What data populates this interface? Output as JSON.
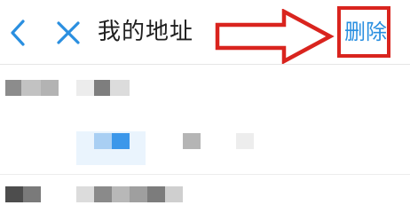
{
  "header": {
    "back_icon": "chevron-left-icon",
    "close_icon": "close-icon",
    "title": "我的地址",
    "delete_label": "删除"
  },
  "annotation": {
    "arrow": "right-arrow-outline",
    "highlight": "red-box"
  },
  "colors": {
    "accent": "#2a8fe0",
    "annotation_red": "#d9241e",
    "title_text": "#1f1f1f",
    "blur_gray": "#9a9a9a"
  },
  "content": {
    "obscured": true
  }
}
